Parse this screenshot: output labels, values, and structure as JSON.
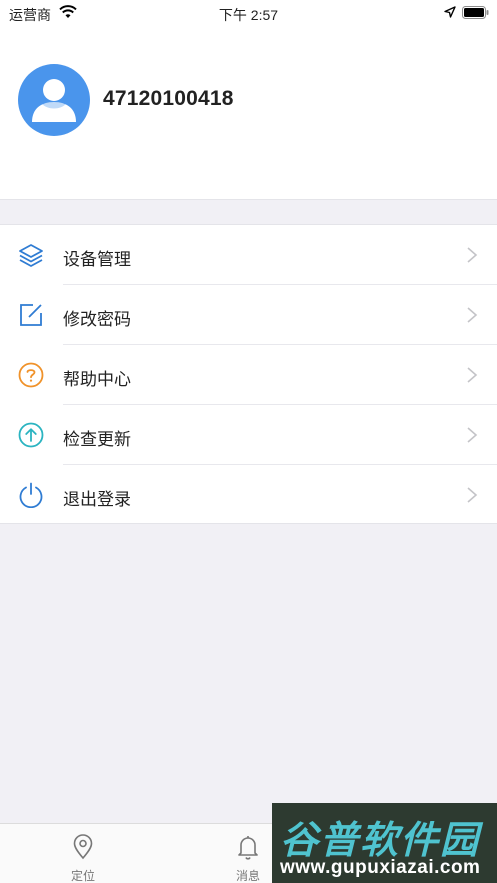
{
  "status_bar": {
    "carrier": "运营商",
    "time": "下午 2:57"
  },
  "profile": {
    "avatar_icon": "person-avatar-icon",
    "username": "47120100418"
  },
  "menu": {
    "items": [
      {
        "label": "设备管理",
        "icon": "layers-icon",
        "color": "#2f7cd3"
      },
      {
        "label": "修改密码",
        "icon": "edit-icon",
        "color": "#2f7cd3"
      },
      {
        "label": "帮助中心",
        "icon": "question-icon",
        "color": "#f0922a"
      },
      {
        "label": "检查更新",
        "icon": "upload-arrow-icon",
        "color": "#2bb4c1"
      },
      {
        "label": "退出登录",
        "icon": "power-icon",
        "color": "#2f7cd3"
      }
    ]
  },
  "tabbar": {
    "tabs": [
      {
        "label": "定位",
        "icon": "location-pin-icon"
      },
      {
        "label": "消息",
        "icon": "bell-icon"
      }
    ]
  },
  "watermark": {
    "line1": "谷普软件园",
    "line2": "www.gupuxiazai.com"
  },
  "colors": {
    "avatar": "#4a95ec",
    "background": "#f1f0f5",
    "watermark_bg": "#2d3a30",
    "watermark_text": "#4fc3cf"
  }
}
